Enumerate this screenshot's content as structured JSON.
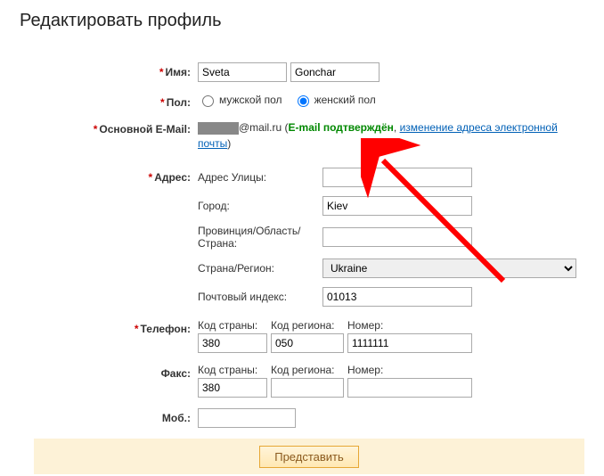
{
  "page_title": "Редактировать профиль",
  "labels": {
    "name": "Имя:",
    "gender": "Пол:",
    "email": "Основной E-Mail:",
    "address": "Адрес:",
    "phone": "Телефон:",
    "fax": "Факс:",
    "mobile": "Моб.:"
  },
  "name": {
    "first": "Sveta",
    "last": "Gonchar"
  },
  "gender": {
    "male_label": "мужской пол",
    "female_label": "женский пол",
    "selected": "female"
  },
  "email": {
    "domain": "@mail.ru",
    "paren_open": " (",
    "verified_text": "E-mail подтверждён",
    "comma": ", ",
    "change_link": "изменение адреса электронной почты",
    "paren_close": ")"
  },
  "address": {
    "street_label": "Адрес Улицы:",
    "street": "",
    "city_label": "Город:",
    "city": "Kiev",
    "province_label": "Провинция/Область/\nСтрана:",
    "province": "",
    "country_label": "Страна/Регион:",
    "country": "Ukraine",
    "zip_label": "Почтовый индекс:",
    "zip": "01013"
  },
  "phone_labels": {
    "country": "Код страны:",
    "area": "Код региона:",
    "number": "Номер:"
  },
  "phone": {
    "country": "380",
    "area": "050",
    "number": "1111111"
  },
  "fax": {
    "country": "380",
    "area": "",
    "number": ""
  },
  "mobile": "",
  "submit_label": "Представить"
}
